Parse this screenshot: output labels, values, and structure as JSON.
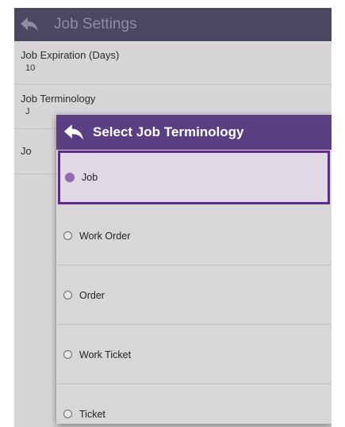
{
  "app_bar": {
    "title": "Job Settings"
  },
  "settings": [
    {
      "label": "Job Expiration (Days)",
      "value": "10"
    },
    {
      "label": "Job Terminology",
      "value": "J"
    },
    {
      "label": "Jo"
    }
  ],
  "dialog": {
    "title": "Select Job Terminology",
    "selected": "Job",
    "options": [
      {
        "label": "Job"
      },
      {
        "label": "Work Order"
      },
      {
        "label": "Order"
      },
      {
        "label": "Work Ticket"
      },
      {
        "label": "Ticket"
      }
    ]
  },
  "colors": {
    "app_bar": "#4a4760",
    "dialog_header": "#5b3f85",
    "selected_border": "#5b2c89",
    "radio_selected": "#8f6cb8"
  }
}
